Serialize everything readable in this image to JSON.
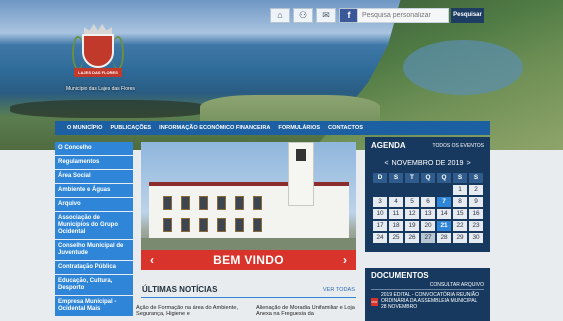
{
  "header": {
    "tool_icons": [
      "home-icon",
      "sitemap-icon",
      "mail-icon",
      "facebook-icon"
    ],
    "search": {
      "placeholder": "Pesquisa personalizar",
      "button_label": "Pesquisar"
    },
    "logo": {
      "ribbon_text": "LAJES DAS FLORES",
      "municipality": "Município das Lajes das Flores"
    }
  },
  "nav": {
    "items": [
      "O MUNICÍPIO",
      "PUBLICAÇÕES",
      "INFORMAÇÃO ECONÓMICO FINANCEIRA",
      "FORMULÁRIOS",
      "CONTACTOS"
    ]
  },
  "sidebar": {
    "items": [
      "O Concelho",
      "Regulamentos",
      "Área Social",
      "Ambiente e Águas",
      "Arquivo",
      "Associação de Municípios do Grupo Ocidental",
      "Conselho Municipal de Juventude",
      "Contratação Pública",
      "Educação, Cultura, Desporto",
      "Empresa Municipal - Ocidental Mais"
    ]
  },
  "banner": {
    "title": "BEM VINDO",
    "prev": "‹",
    "next": "›"
  },
  "news": {
    "title": "ÚLTIMAS NOTÍCIAS",
    "view_all": "VER TODAS",
    "items": [
      "Ação de Formação na área do Ambiente, Segurança, Higiene e",
      "Alienação de Moradia Unifamiliar e Loja Anexa na Freguesia da"
    ]
  },
  "agenda": {
    "title": "AGENDA",
    "view_all": "TODOS OS EVENTOS",
    "month_label": "NOVEMBRO DE 2019",
    "prev": "<",
    "next": ">",
    "weekdays": [
      "D",
      "S",
      "T",
      "Q",
      "Q",
      "S",
      "S"
    ],
    "leading_empty": 5,
    "days": [
      "1",
      "2",
      "3",
      "4",
      "5",
      "6",
      "7",
      "8",
      "9",
      "10",
      "11",
      "12",
      "13",
      "14",
      "15",
      "16",
      "17",
      "18",
      "19",
      "20",
      "21",
      "22",
      "23",
      "24",
      "25",
      "26",
      "27",
      "28",
      "29",
      "30"
    ],
    "highlight_days": [
      "7",
      "21"
    ],
    "marked_days": [
      "27"
    ]
  },
  "documents": {
    "title": "DOCUMENTOS",
    "view_all": "CONSULTAR ARQUIVO",
    "items": [
      {
        "icon": "pdf-icon",
        "text": "2019 EDITAL - CONVOCATÓRIA REUNIÃO ORDINÁRIA DA ASSEMBLEIA MUNICIPAL 28 NOVEMBRO"
      }
    ]
  }
}
